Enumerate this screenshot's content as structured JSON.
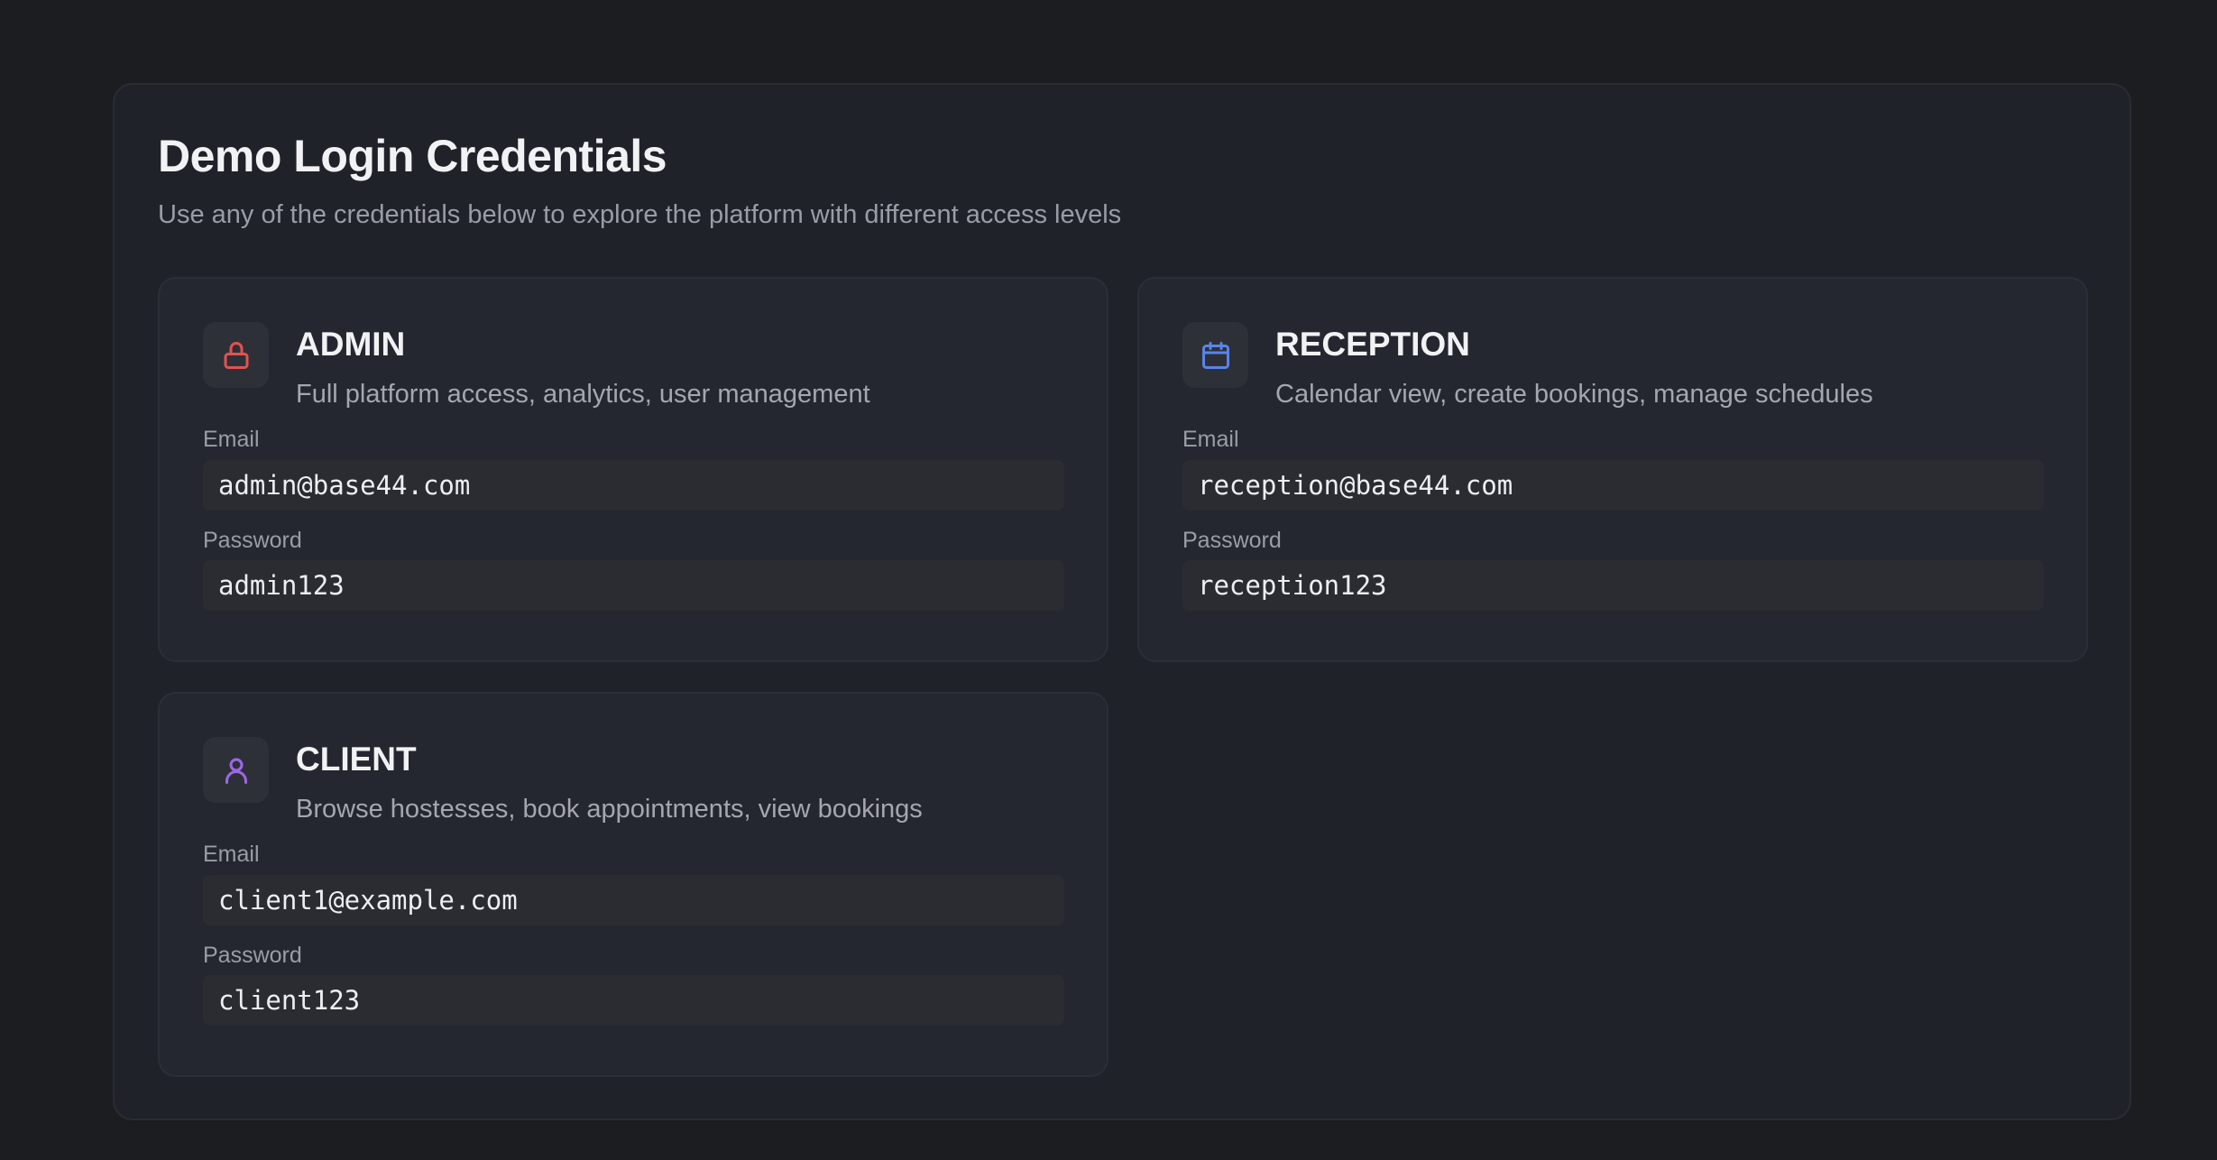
{
  "header": {
    "title": "Demo Login Credentials",
    "subtitle": "Use any of the credentials below to explore the platform with different access levels"
  },
  "credentials": [
    {
      "role": "ADMIN",
      "description": "Full platform access, analytics, user management",
      "icon": "lock-icon",
      "icon_color": "#e0544f",
      "email_label": "Email",
      "email": "admin@base44.com",
      "password_label": "Password",
      "password": "admin123"
    },
    {
      "role": "RECEPTION",
      "description": "Calendar view, create bookings, manage schedules",
      "icon": "calendar-icon",
      "icon_color": "#5a84e6",
      "email_label": "Email",
      "email": "reception@base44.com",
      "password_label": "Password",
      "password": "reception123"
    },
    {
      "role": "CLIENT",
      "description": "Browse hostesses, book appointments, view bookings",
      "icon": "user-icon",
      "icon_color": "#9d68e8",
      "email_label": "Email",
      "email": "client1@example.com",
      "password_label": "Password",
      "password": "client123"
    }
  ],
  "colors": {
    "background": "#1c1d21",
    "panel": "#20222a",
    "card": "#252730",
    "field": "#2b2c32"
  }
}
